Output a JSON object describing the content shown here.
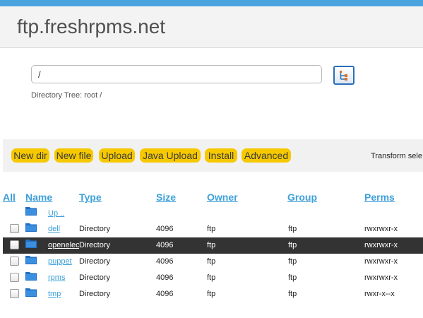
{
  "header": {
    "title": "ftp.freshrpms.net"
  },
  "path": {
    "value": "/",
    "tree_label": "Directory Tree: root /"
  },
  "toolbar": {
    "buttons": [
      "New dir",
      "New file",
      "Upload",
      "Java Upload",
      "Install",
      "Advanced"
    ],
    "transform_label": "Transform sele"
  },
  "table": {
    "columns": [
      "All",
      "Name",
      "Type",
      "Size",
      "Owner",
      "Group",
      "Perms"
    ],
    "up_label": "Up ..",
    "rows": [
      {
        "name": "dell",
        "type": "Directory",
        "size": "4096",
        "owner": "ftp",
        "group": "ftp",
        "perms": "rwxrwxr-x",
        "selected": false
      },
      {
        "name": "openelec",
        "type": "Directory",
        "size": "4096",
        "owner": "ftp",
        "group": "ftp",
        "perms": "rwxrwxr-x",
        "selected": true
      },
      {
        "name": "puppet",
        "type": "Directory",
        "size": "4096",
        "owner": "ftp",
        "group": "ftp",
        "perms": "rwxrwxr-x",
        "selected": false
      },
      {
        "name": "rpms",
        "type": "Directory",
        "size": "4096",
        "owner": "ftp",
        "group": "ftp",
        "perms": "rwxrwxr-x",
        "selected": false
      },
      {
        "name": "tmp",
        "type": "Directory",
        "size": "4096",
        "owner": "ftp",
        "group": "ftp",
        "perms": "rwxr-x--x",
        "selected": false
      }
    ]
  },
  "colors": {
    "accent": "#4aa3df",
    "button": "#f6c800",
    "link": "#3ea0d9",
    "selected_row": "#333333"
  },
  "icons": {
    "folder": "folder-icon",
    "tree": "directory-tree-icon"
  }
}
